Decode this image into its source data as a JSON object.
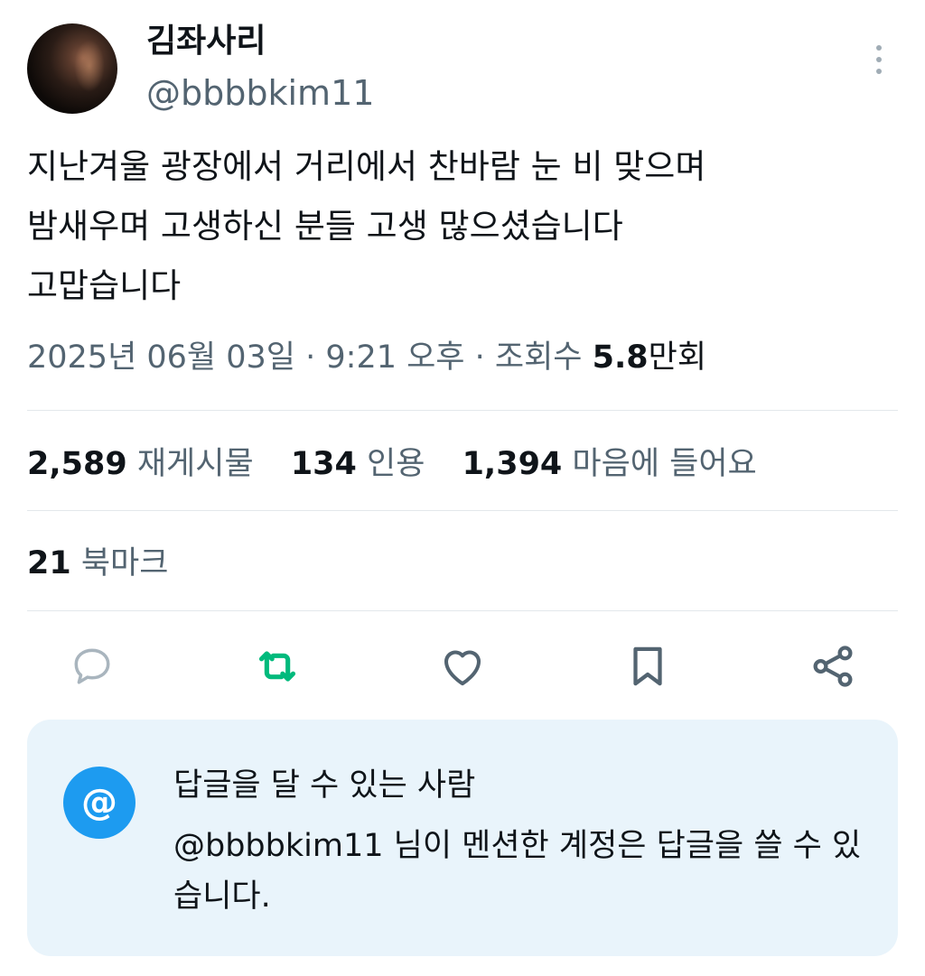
{
  "author": {
    "display_name": "김좌사리",
    "handle": "@bbbbkim11"
  },
  "tweet": {
    "text": "지난겨울 광장에서 거리에서 찬바람 눈 비 맞으며\n밤새우며 고생하신 분들 고생 많으셨습니다\n고맙습니다"
  },
  "meta": {
    "date": "2025년 06월 03일",
    "separator": " · ",
    "time": "9:21 오후",
    "views_label": "조회수",
    "views_value": "5.8",
    "views_unit": "만회"
  },
  "stats": {
    "reposts_count": "2,589",
    "reposts_label": "재게시물",
    "quotes_count": "134",
    "quotes_label": "인용",
    "likes_count": "1,394",
    "likes_label": "마음에 들어요",
    "bookmarks_count": "21",
    "bookmarks_label": "북마크"
  },
  "actions": [
    {
      "icon": "reply-icon",
      "active": false
    },
    {
      "icon": "repost-icon",
      "active": true
    },
    {
      "icon": "like-icon",
      "active": false
    },
    {
      "icon": "bookmark-icon",
      "active": false
    },
    {
      "icon": "share-icon",
      "active": false
    }
  ],
  "reply_restriction": {
    "icon": "mention-icon",
    "symbol": "@",
    "title": "답글을 달 수 있는 사람",
    "description": "@bbbbkim11 님이 멘션한 계정은 답글을 쓸 수 있습니다."
  },
  "colors": {
    "text_primary": "#0f1419",
    "text_secondary": "#536471",
    "repost_active": "#00ba7c",
    "accent": "#1d9bf0",
    "reply_box_bg": "#e9f4fb",
    "divider": "#e3e8eb"
  }
}
